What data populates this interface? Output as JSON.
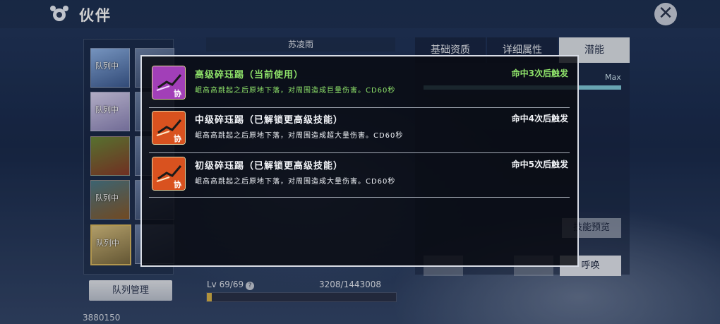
{
  "header": {
    "title": "伙伴",
    "close_icon": "close-x-icon"
  },
  "party": {
    "slots": [
      {
        "badge": "队列中"
      },
      {
        "badge": "队列中"
      },
      {
        "badge": ""
      },
      {
        "badge": "队列中"
      },
      {
        "badge": "队列中"
      }
    ],
    "manage_button": "队列管理",
    "power": "3880150"
  },
  "character": {
    "name": "苏凌雨",
    "level_label": "Lv 69/69",
    "exp_text": "3208/1443008",
    "exp_progress": 0.0022
  },
  "right_panel": {
    "tabs": [
      "基础资质",
      "详细属性",
      "潜能"
    ],
    "active_tab": "潜能",
    "max_label": "Max",
    "preview_button": "技能预览",
    "summon_button": "呼唤"
  },
  "skill_modal": {
    "skills": [
      {
        "name": "高级碎珏踢（当前使用）",
        "desc": "岷高高跳起之后原地下落，对周围造成巨量伤害。CD60秒",
        "trigger": "命中3次后触发",
        "active": true,
        "icon_tag": "协",
        "icon_color": "#a23fb8"
      },
      {
        "name": "中级碎珏踢（已解锁更高级技能）",
        "desc": "岷高高跳起之后原地下落，对周围造成超大量伤害。CD60秒",
        "trigger": "命中4次后触发",
        "active": false,
        "icon_tag": "协",
        "icon_color": "#d9521f"
      },
      {
        "name": "初级碎珏踢（已解锁更高级技能）",
        "desc": "岷高高跳起之后原地下落，对周围造成大量伤害。CD60秒",
        "trigger": "命中5次后触发",
        "active": false,
        "icon_tag": "协",
        "icon_color": "#d9521f"
      }
    ]
  }
}
